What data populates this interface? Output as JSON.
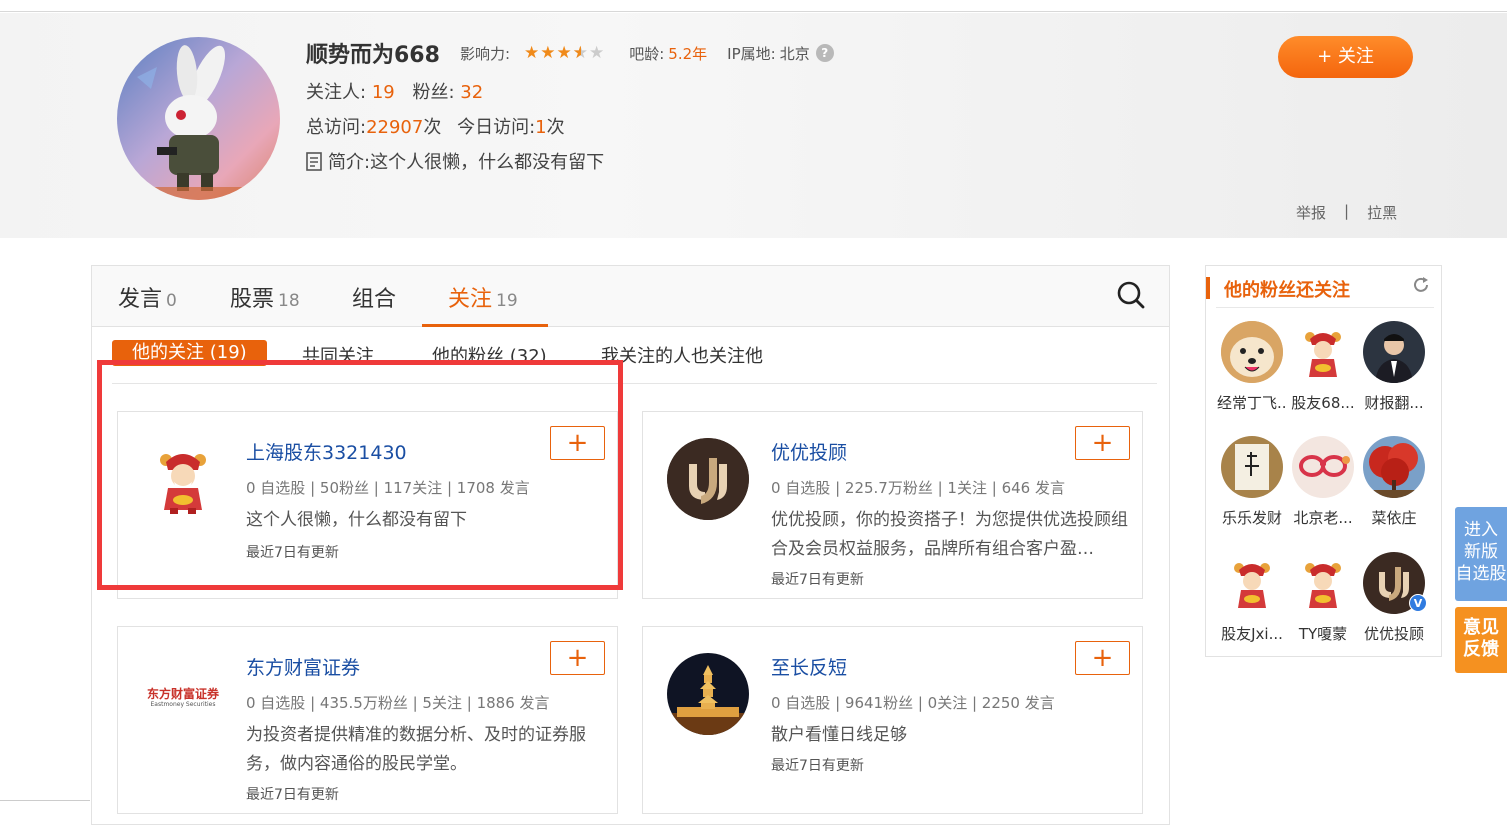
{
  "profile": {
    "name": "顺势而为668",
    "influence_label": "影响力:",
    "influence_stars": 3.5,
    "age_label": "吧龄:",
    "age_value": "5.2年",
    "ip_label": "IP属地:",
    "ip_value": "北京",
    "ip_help": "?",
    "following_label": "关注人:",
    "following_value": "19",
    "fans_label": "粉丝:",
    "fans_value": "32",
    "visits_label": "总访问:",
    "visits_value": "22907",
    "visits_unit": "次",
    "today_label": "今日访问:",
    "today_value": "1",
    "today_unit": "次",
    "bio_label": "简介:",
    "bio_value": "这个人很懒，什么都没有留下",
    "follow_button": "+ 关注",
    "report": "举报",
    "separator": "|",
    "block": "拉黑"
  },
  "tabs": [
    {
      "label": "发言",
      "count": "0"
    },
    {
      "label": "股票",
      "count": "18"
    },
    {
      "label": "组合",
      "count": ""
    },
    {
      "label": "关注",
      "count": "19"
    }
  ],
  "subtabs": [
    "他的关注 (19)",
    "共同关注",
    "他的粉丝 (32)",
    "我关注的人也关注他"
  ],
  "cards": [
    {
      "name": "上海股东3321430",
      "stats": "0 自选股 | 50粉丝 | 117关注 | 1708 发言",
      "desc": "这个人很懒，什么都没有留下",
      "updated": "最近7日有更新",
      "avatar": "caishen-avatar"
    },
    {
      "name": "优优投顾",
      "stats": "0 自选股 | 225.7万粉丝 | 1关注 | 646 发言",
      "desc": "优优投顾，你的投资搭子！为您提供优选投顾组合及会员权益服务，品牌所有组合客户盈…",
      "updated": "最近7日有更新",
      "avatar": "uu-logo-avatar"
    },
    {
      "name": "东方财富证券",
      "stats": "0 自选股 | 435.5万粉丝 | 5关注 | 1886 发言",
      "desc": "为投资者提供精准的数据分析、及时的证券服务，做内容通俗的股民学堂。",
      "updated": "最近7日有更新",
      "avatar": "eastmoney-logo-avatar",
      "logo_text": "东方财富证券",
      "logo_sub": "Eastmoney Securities"
    },
    {
      "name": "至长反短",
      "stats": "0 自选股 | 9641粉丝 | 0关注 | 2250 发言",
      "desc": "散户看懂日线足够",
      "updated": "最近7日有更新",
      "avatar": "pagoda-night-avatar"
    }
  ],
  "plus": "+",
  "side": {
    "title": "他的粉丝还关注",
    "fans": [
      {
        "label": "经常丁飞...",
        "avatar": "shiba-dog"
      },
      {
        "label": "股友68...",
        "avatar": "caishen"
      },
      {
        "label": "财报翻...",
        "avatar": "man-suit"
      },
      {
        "label": "乐乐发财",
        "avatar": "calligraphy"
      },
      {
        "label": "北京老...",
        "avatar": "glasses"
      },
      {
        "label": "菜依庄",
        "avatar": "red-tree"
      },
      {
        "label": "股友Jxi...",
        "avatar": "caishen"
      },
      {
        "label": "TY嗄蒙",
        "avatar": "caishen"
      },
      {
        "label": "优优投顾",
        "avatar": "uu-logo-verified"
      }
    ],
    "verified_badge": "V"
  },
  "float_buttons": [
    {
      "label": "进入新版自选股",
      "lines": [
        "进入",
        "新版",
        "自选股"
      ],
      "color": "#6fa3e0"
    },
    {
      "label": "意见反馈",
      "lines": [
        "意见",
        "反馈"
      ],
      "color": "#f59120"
    }
  ],
  "colors": {
    "accent": "#e8620c",
    "link": "#1a4ea3",
    "highlight": "#ef3a3a"
  }
}
